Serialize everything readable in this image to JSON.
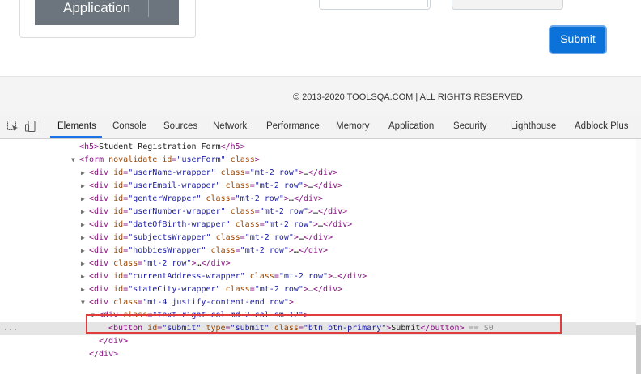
{
  "page": {
    "app_button_label": "Application",
    "submit_label": "Submit",
    "footer_text": "© 2013-2020 TOOLSQA.COM | ALL RIGHTS RESERVED."
  },
  "devtools": {
    "tabs": [
      "Elements",
      "Console",
      "Sources",
      "Network",
      "Performance",
      "Memory",
      "Application",
      "Security",
      "Lighthouse",
      "Adblock Plus"
    ],
    "active_tab": "Elements",
    "lines": [
      {
        "parts": [
          [
            "t",
            "<h5>"
          ],
          [
            "x",
            "Student Registration Form"
          ],
          [
            "t",
            "</h5>"
          ]
        ]
      },
      {
        "parts": [
          [
            "t",
            "<form "
          ],
          [
            "a",
            "novalidate"
          ],
          [
            "a",
            " id"
          ],
          [
            "t",
            "="
          ],
          [
            "v",
            "\"userForm\""
          ],
          [
            "a",
            " class"
          ],
          [
            "t",
            ">"
          ]
        ]
      },
      {
        "parts": [
          [
            "t",
            "<div "
          ],
          [
            "a",
            "id"
          ],
          [
            "t",
            "="
          ],
          [
            "v",
            "\"userName-wrapper\""
          ],
          [
            "a",
            " class"
          ],
          [
            "t",
            "="
          ],
          [
            "v",
            "\"mt-2 row\""
          ],
          [
            "t",
            ">"
          ],
          [
            "x",
            "…"
          ],
          [
            "t",
            "</div>"
          ]
        ]
      },
      {
        "parts": [
          [
            "t",
            "<div "
          ],
          [
            "a",
            "id"
          ],
          [
            "t",
            "="
          ],
          [
            "v",
            "\"userEmail-wrapper\""
          ],
          [
            "a",
            " class"
          ],
          [
            "t",
            "="
          ],
          [
            "v",
            "\"mt-2 row\""
          ],
          [
            "t",
            ">"
          ],
          [
            "x",
            "…"
          ],
          [
            "t",
            "</div>"
          ]
        ]
      },
      {
        "parts": [
          [
            "t",
            "<div "
          ],
          [
            "a",
            "id"
          ],
          [
            "t",
            "="
          ],
          [
            "v",
            "\"genterWrapper\""
          ],
          [
            "a",
            " class"
          ],
          [
            "t",
            "="
          ],
          [
            "v",
            "\"mt-2 row\""
          ],
          [
            "t",
            ">"
          ],
          [
            "x",
            "…"
          ],
          [
            "t",
            "</div>"
          ]
        ]
      },
      {
        "parts": [
          [
            "t",
            "<div "
          ],
          [
            "a",
            "id"
          ],
          [
            "t",
            "="
          ],
          [
            "v",
            "\"userNumber-wrapper\""
          ],
          [
            "a",
            " class"
          ],
          [
            "t",
            "="
          ],
          [
            "v",
            "\"mt-2 row\""
          ],
          [
            "t",
            ">"
          ],
          [
            "x",
            "…"
          ],
          [
            "t",
            "</div>"
          ]
        ]
      },
      {
        "parts": [
          [
            "t",
            "<div "
          ],
          [
            "a",
            "id"
          ],
          [
            "t",
            "="
          ],
          [
            "v",
            "\"dateOfBirth-wrapper\""
          ],
          [
            "a",
            " class"
          ],
          [
            "t",
            "="
          ],
          [
            "v",
            "\"mt-2 row\""
          ],
          [
            "t",
            ">"
          ],
          [
            "x",
            "…"
          ],
          [
            "t",
            "</div>"
          ]
        ]
      },
      {
        "parts": [
          [
            "t",
            "<div "
          ],
          [
            "a",
            "id"
          ],
          [
            "t",
            "="
          ],
          [
            "v",
            "\"subjectsWrapper\""
          ],
          [
            "a",
            " class"
          ],
          [
            "t",
            "="
          ],
          [
            "v",
            "\"mt-2 row\""
          ],
          [
            "t",
            ">"
          ],
          [
            "x",
            "…"
          ],
          [
            "t",
            "</div>"
          ]
        ]
      },
      {
        "parts": [
          [
            "t",
            "<div "
          ],
          [
            "a",
            "id"
          ],
          [
            "t",
            "="
          ],
          [
            "v",
            "\"hobbiesWrapper\""
          ],
          [
            "a",
            " class"
          ],
          [
            "t",
            "="
          ],
          [
            "v",
            "\"mt-2 row\""
          ],
          [
            "t",
            ">"
          ],
          [
            "x",
            "…"
          ],
          [
            "t",
            "</div>"
          ]
        ]
      },
      {
        "parts": [
          [
            "t",
            "<div "
          ],
          [
            "a",
            "class"
          ],
          [
            "t",
            "="
          ],
          [
            "v",
            "\"mt-2 row\""
          ],
          [
            "t",
            ">"
          ],
          [
            "x",
            "…"
          ],
          [
            "t",
            "</div>"
          ]
        ]
      },
      {
        "parts": [
          [
            "t",
            "<div "
          ],
          [
            "a",
            "id"
          ],
          [
            "t",
            "="
          ],
          [
            "v",
            "\"currentAddress-wrapper\""
          ],
          [
            "a",
            " class"
          ],
          [
            "t",
            "="
          ],
          [
            "v",
            "\"mt-2 row\""
          ],
          [
            "t",
            ">"
          ],
          [
            "x",
            "…"
          ],
          [
            "t",
            "</div>"
          ]
        ]
      },
      {
        "parts": [
          [
            "t",
            "<div "
          ],
          [
            "a",
            "id"
          ],
          [
            "t",
            "="
          ],
          [
            "v",
            "\"stateCity-wrapper\""
          ],
          [
            "a",
            " class"
          ],
          [
            "t",
            "="
          ],
          [
            "v",
            "\"mt-2 row\""
          ],
          [
            "t",
            ">"
          ],
          [
            "x",
            "…"
          ],
          [
            "t",
            "</div>"
          ]
        ]
      },
      {
        "parts": [
          [
            "t",
            "<div "
          ],
          [
            "a",
            "class"
          ],
          [
            "t",
            "="
          ],
          [
            "v",
            "\"mt-4 justify-content-end row\""
          ],
          [
            "t",
            ">"
          ]
        ]
      },
      {
        "parts": [
          [
            "t",
            "<div "
          ],
          [
            "a",
            "class"
          ],
          [
            "t",
            "="
          ],
          [
            "v",
            "\"text-right col-md-2 col-sm-12\""
          ],
          [
            "t",
            ">"
          ]
        ]
      },
      {
        "parts": [
          [
            "t",
            "<button "
          ],
          [
            "a",
            "id"
          ],
          [
            "t",
            "="
          ],
          [
            "v",
            "\"submit\""
          ],
          [
            "a",
            " type"
          ],
          [
            "t",
            "="
          ],
          [
            "v",
            "\"submit\""
          ],
          [
            "a",
            " class"
          ],
          [
            "t",
            "="
          ],
          [
            "v",
            "\"btn btn-primary\""
          ],
          [
            "t",
            ">"
          ],
          [
            "x",
            "Submit"
          ],
          [
            "t",
            "</button>"
          ],
          [
            "d",
            " == $0"
          ]
        ]
      },
      {
        "parts": [
          [
            "t",
            "</div>"
          ]
        ]
      },
      {
        "parts": [
          [
            "t",
            "</div>"
          ]
        ]
      }
    ],
    "ellipsis": "..."
  }
}
